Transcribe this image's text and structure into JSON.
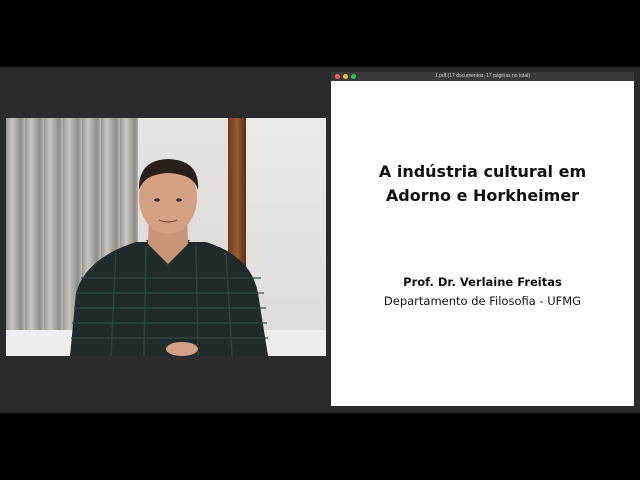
{
  "window": {
    "title": "1.pdf (17 documentos, 17 páginas no total)"
  },
  "slide": {
    "title_line1": "A indústria cultural em",
    "title_line2": "Adorno e Horkheimer",
    "author": "Prof. Dr. Verlaine Freitas",
    "department": "Departamento de Filosofia - UFMG"
  },
  "colors": {
    "stage_background": "#2b2b2d",
    "letterbox": "#000000",
    "slide_background": "#ffffff",
    "shirt": "#1f2a2a"
  }
}
